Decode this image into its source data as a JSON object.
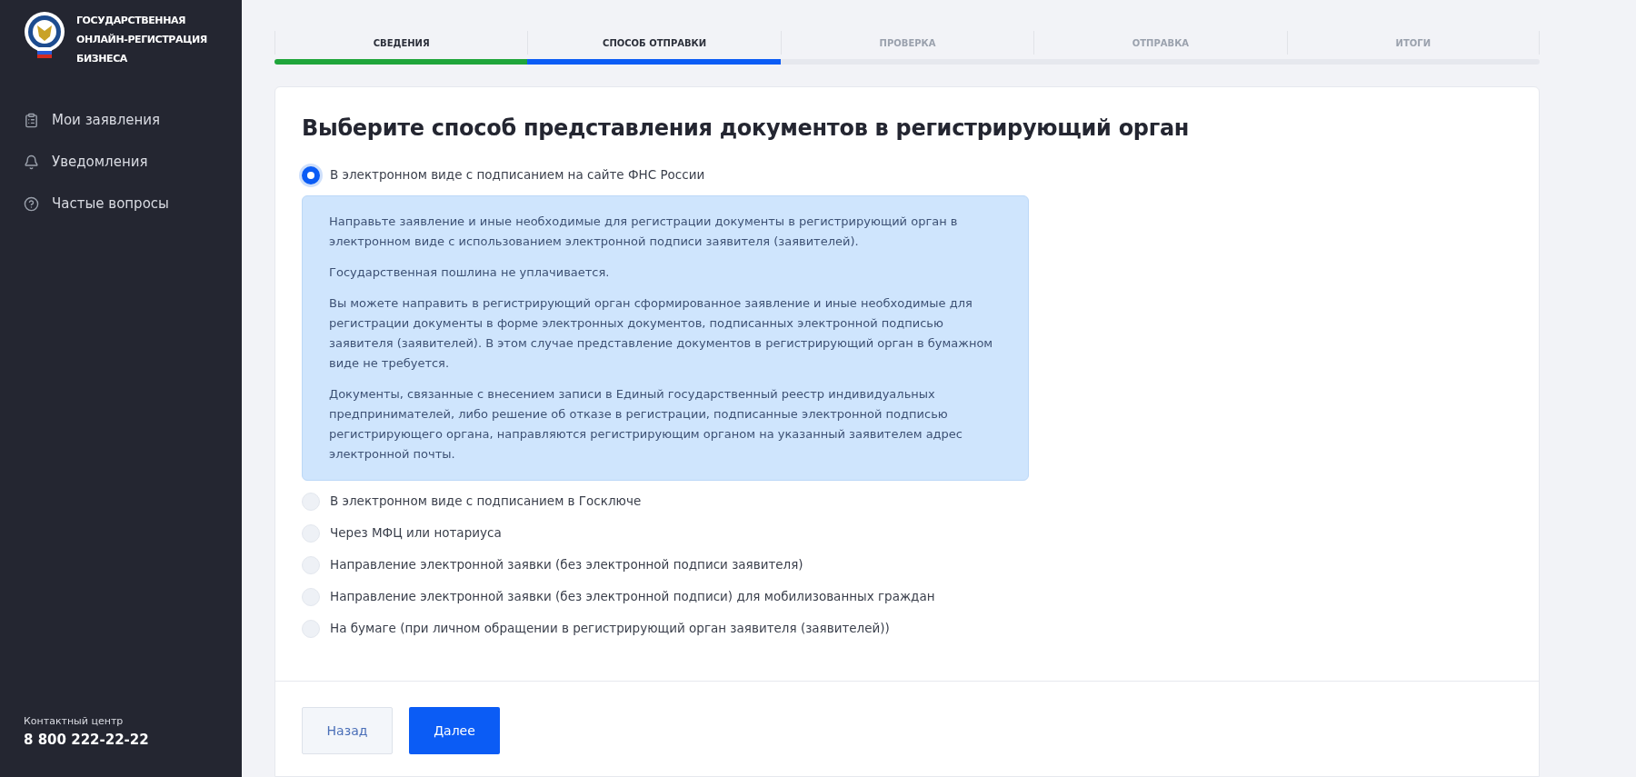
{
  "brand": {
    "title_lines": [
      "ГОСУДАРСТВЕННАЯ",
      "ОНЛАЙН-РЕГИСТРАЦИЯ",
      "БИЗНЕСА"
    ]
  },
  "sidebar": {
    "items": [
      {
        "label": "Мои заявления"
      },
      {
        "label": "Уведомления"
      },
      {
        "label": "Частые вопросы"
      }
    ],
    "contact": {
      "label": "Контактный центр",
      "phone": "8 800 222-22-22"
    }
  },
  "steps": [
    {
      "label": "СВЕДЕНИЯ",
      "completed": true,
      "selected": false
    },
    {
      "label": "СПОСОБ ОТПРАВКИ",
      "completed": false,
      "selected": true
    },
    {
      "label": "ПРОВЕРКА",
      "completed": false,
      "selected": false
    },
    {
      "label": "ОТПРАВКА",
      "completed": false,
      "selected": false
    },
    {
      "label": "ИТОГИ",
      "completed": false,
      "selected": false
    }
  ],
  "form": {
    "title": "Выберите способ представления документов в регистрирующий орган",
    "options": [
      {
        "label": "В электронном виде с подписанием на сайте ФНС России",
        "selected": true,
        "details": [
          "Направьте заявление и иные необходимые для регистрации документы в регистрирующий орган в электронном виде с использованием электронной подписи заявителя (заявителей).",
          "Государственная пошлина не уплачивается.",
          "Вы можете направить в регистрирующий орган сформированное заявление и иные необходимые для регистрации документы в форме электронных документов, подписанных электронной подписью заявителя (заявителей). В этом случае представление документов в регистрирующий орган в бумажном виде не требуется.",
          "Документы, связанные с внесением записи в Единый государственный реестр индивидуальных предпринимателей, либо решение об отказе в регистрации, подписанные электронной подписью регистрирующего органа, направляются регистрирующим органом на указанный заявителем адрес электронной почты."
        ]
      },
      {
        "label": "В электронном виде с подписанием в Госключе",
        "selected": false
      },
      {
        "label": "Через МФЦ или нотариуса",
        "selected": false
      },
      {
        "label": "Направление электронной заявки (без электронной подписи заявителя)",
        "selected": false
      },
      {
        "label": "Направление электронной заявки (без электронной подписи) для мобилизованных граждан",
        "selected": false
      },
      {
        "label": "На бумаге (при личном обращении в регистрирующий орган заявителя (заявителей))",
        "selected": false
      }
    ],
    "buttons": [
      {
        "label": "Назад",
        "kind": "secondary"
      },
      {
        "label": "Далее",
        "kind": "primary"
      }
    ]
  }
}
